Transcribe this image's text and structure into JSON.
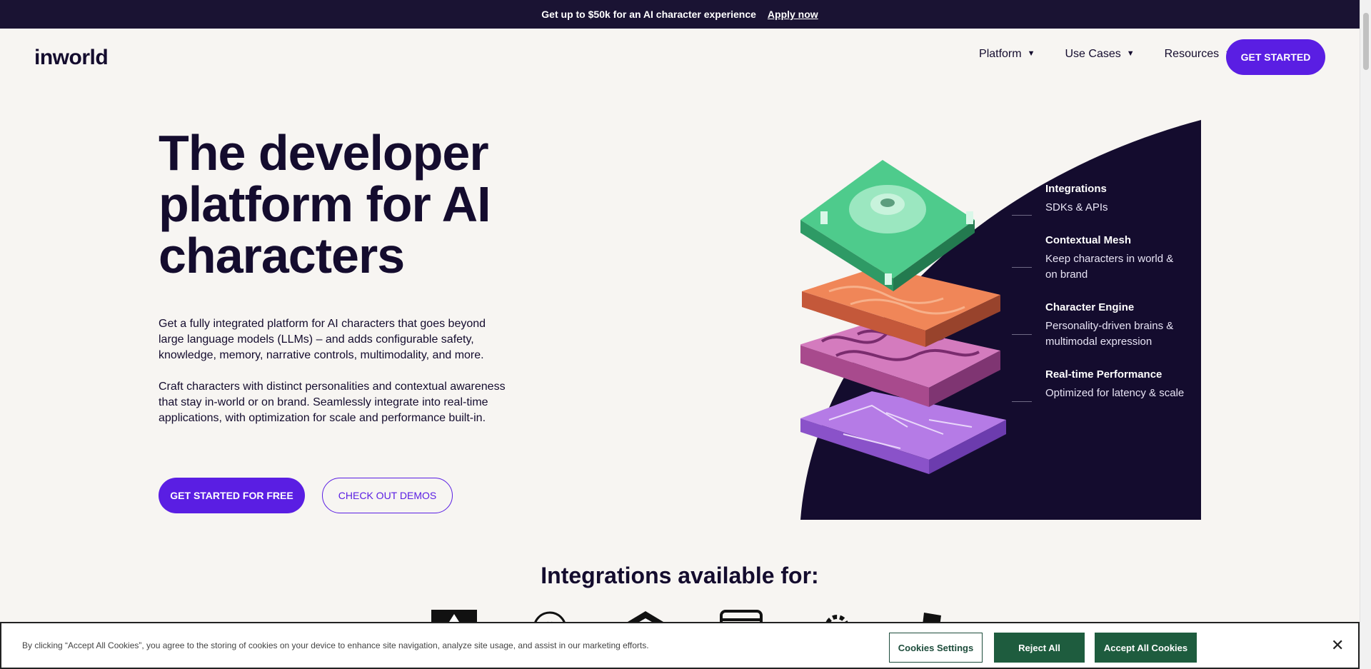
{
  "announcement": {
    "text": "Get up to $50k for an AI character experience",
    "link": "Apply now"
  },
  "nav": {
    "logo": "inworld",
    "items": [
      {
        "label": "Platform"
      },
      {
        "label": "Use Cases"
      },
      {
        "label": "Resources"
      }
    ],
    "cta": "GET STARTED"
  },
  "hero": {
    "title": "The developer platform for AI characters",
    "p1": "Get a fully integrated platform for AI characters that goes beyond large language models (LLMs) – and adds configurable safety, knowledge, memory, narrative controls, multimodality, and more.",
    "p2": "Craft characters with distinct personalities and contextual awareness that stay in-world or on brand. Seamlessly integrate into real-time applications, with optimization for scale and performance built-in.",
    "primary_cta": "GET STARTED FOR FREE",
    "secondary_cta": "CHECK OUT DEMOS"
  },
  "features": [
    {
      "title": "Integrations",
      "desc": "SDKs & APIs"
    },
    {
      "title": "Contextual Mesh",
      "desc": "Keep characters in world & on brand"
    },
    {
      "title": "Character Engine",
      "desc": "Personality-driven brains & multimodal expression"
    },
    {
      "title": "Real-time Performance",
      "desc": "Optimized for latency & scale"
    }
  ],
  "integrations": {
    "title": "Integrations available for:"
  },
  "colors": {
    "brand": "#5a1ee3",
    "dark": "#140c2e",
    "cookie_green": "#1e5c3e"
  },
  "cookie": {
    "text": "By clicking “Accept All Cookies”, you agree to the storing of cookies on your device to enhance site navigation, analyze site usage, and assist in our marketing efforts.",
    "settings": "Cookies Settings",
    "reject": "Reject All",
    "accept": "Accept All Cookies",
    "close": "✕"
  }
}
